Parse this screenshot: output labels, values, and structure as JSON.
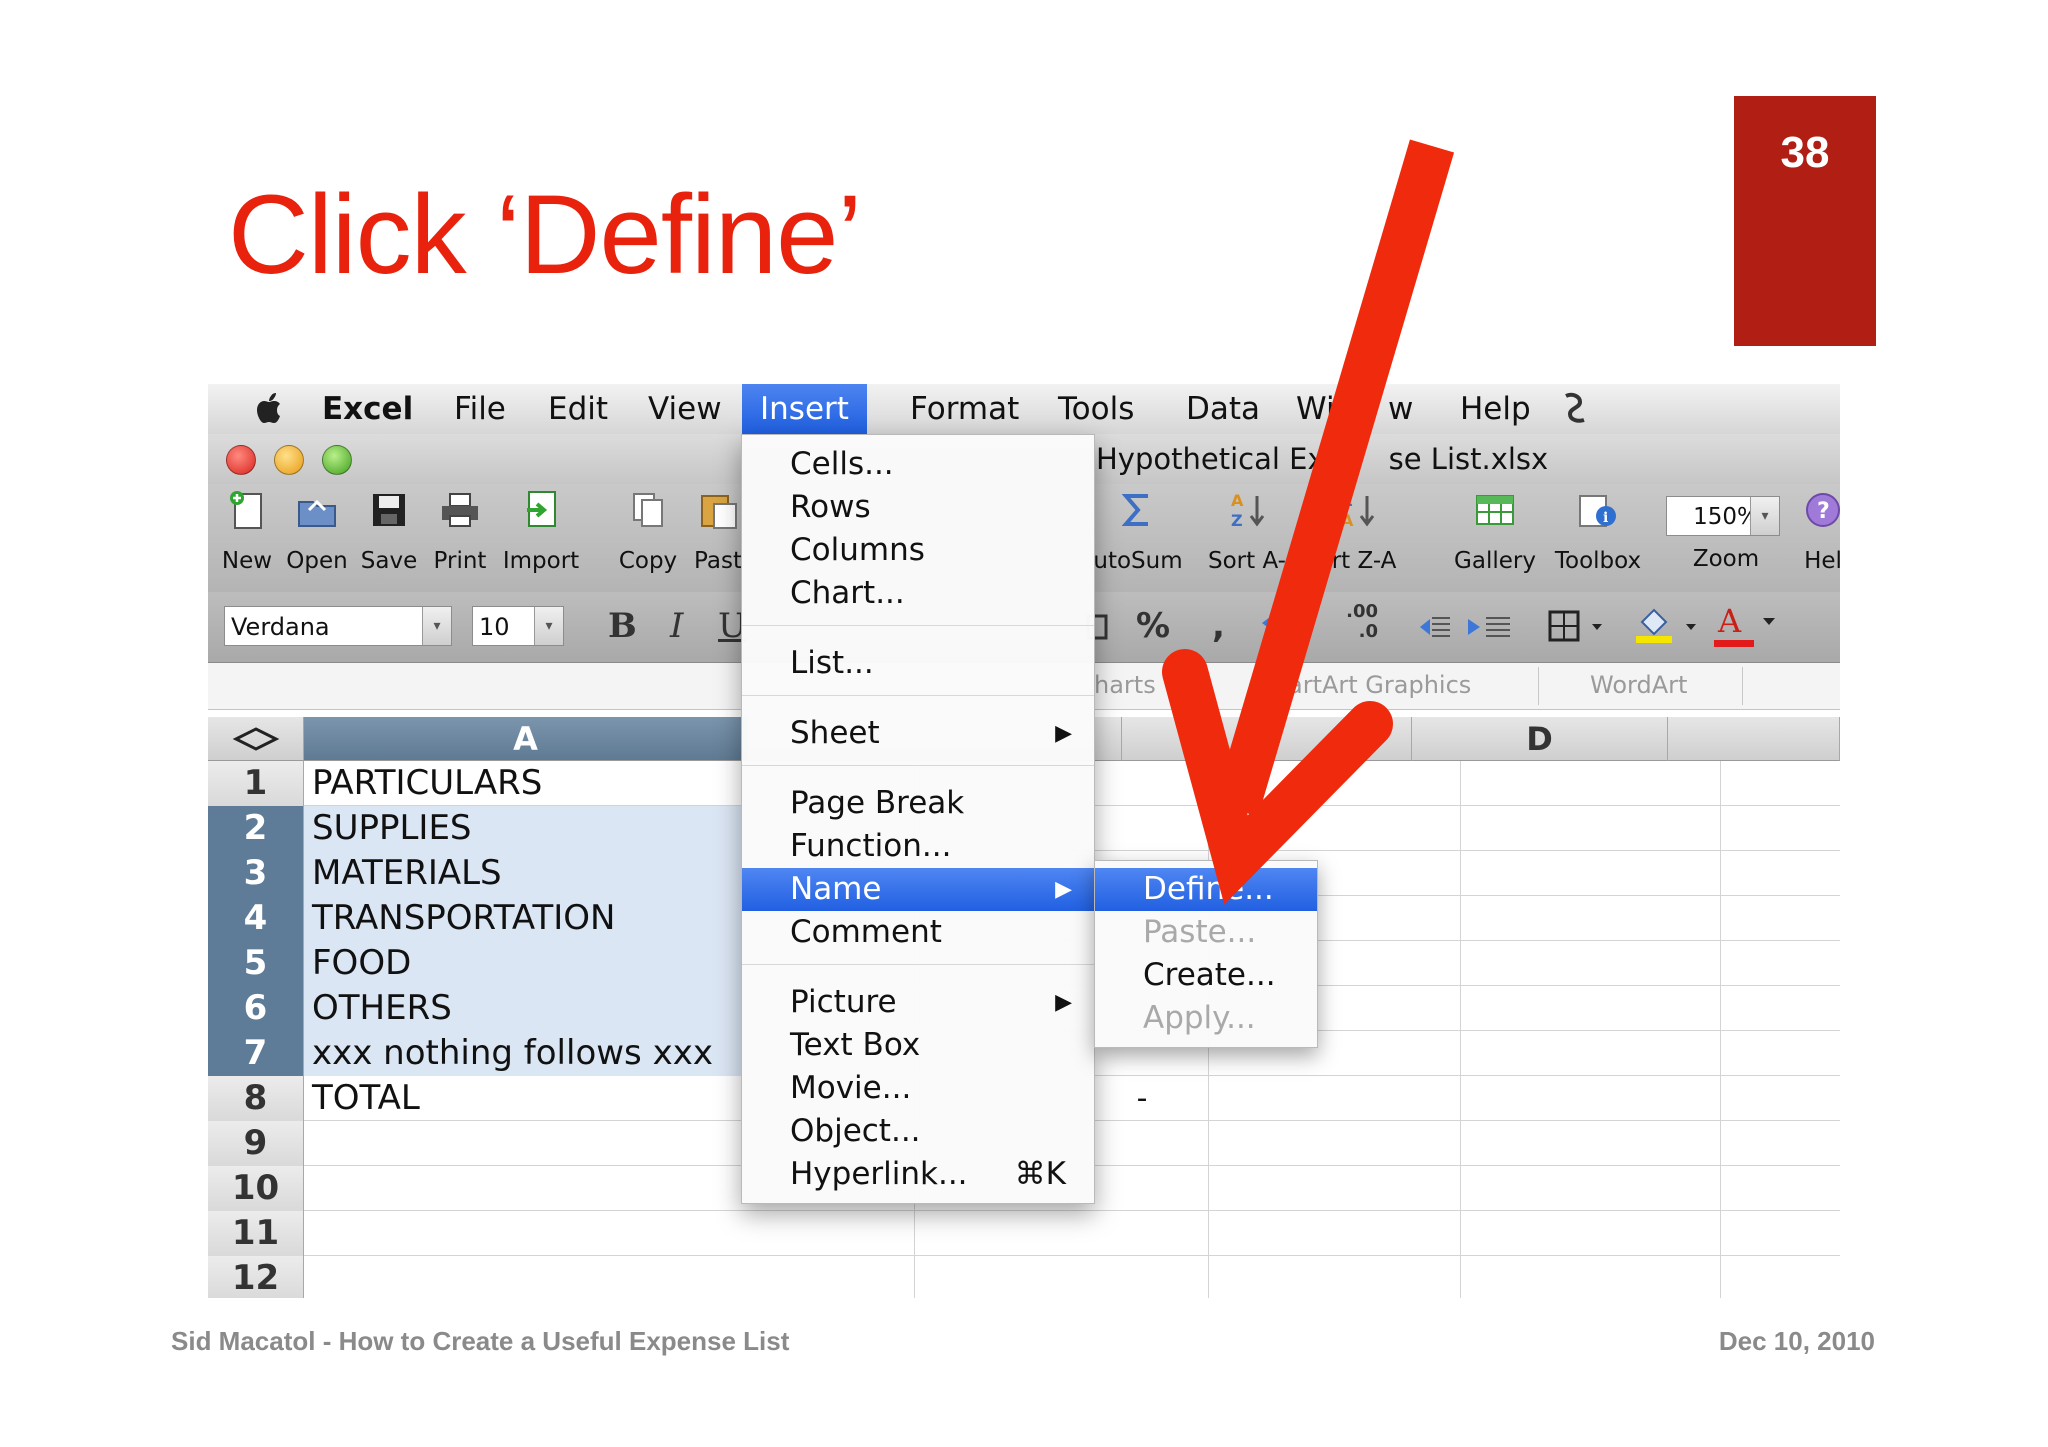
{
  "slide": {
    "title": "Click ‘Define’",
    "page_number": "38",
    "footer_left": "Sid Macatol - How to Create a Useful Expense List",
    "footer_right": "Dec 10, 2010"
  },
  "colors": {
    "title_red": "#e8220c",
    "badge_red": "#b01e14",
    "menu_highlight": "#2a66e6"
  },
  "menubar": {
    "app": "Excel",
    "items": [
      "File",
      "Edit",
      "View",
      "Insert",
      "Format",
      "Tools",
      "Data",
      "Win",
      "w",
      "Help"
    ],
    "active": "Insert"
  },
  "window": {
    "title_left": "Hypothetical Ex",
    "title_right": "se List.xlsx"
  },
  "toolbar": {
    "buttons": [
      {
        "label": "New",
        "icon": "new-document-icon"
      },
      {
        "label": "Open",
        "icon": "open-folder-icon"
      },
      {
        "label": "Save",
        "icon": "save-disk-icon"
      },
      {
        "label": "Print",
        "icon": "printer-icon"
      },
      {
        "label": "Import",
        "icon": "import-icon"
      },
      {
        "label": "Copy",
        "icon": "copy-icon"
      },
      {
        "label": "Past",
        "icon": "paste-icon"
      },
      {
        "label": "utoSum",
        "icon": "sigma-icon"
      },
      {
        "label": "Sort A-",
        "icon": "sort-ascending-icon"
      },
      {
        "label": "ort Z-A",
        "icon": "sort-descending-icon"
      },
      {
        "label": "Gallery",
        "icon": "gallery-icon"
      },
      {
        "label": "Toolbox",
        "icon": "toolbox-icon"
      },
      {
        "label": "Zoom",
        "icon": "zoom-icon"
      },
      {
        "label": "Hel",
        "icon": "help-icon"
      }
    ],
    "zoom_value": "150%"
  },
  "formatting": {
    "font_name": "Verdana",
    "font_size": "10",
    "bold": "B",
    "italic": "I",
    "percent": "%",
    "comma": ",",
    "increase_decimal": ".00",
    "decrease_decimal": ".0",
    "font_color_label": "A"
  },
  "ribbon": {
    "groups": [
      "harts",
      "artArt Graphics",
      "WordArt"
    ]
  },
  "sheet": {
    "column_headers": [
      "A",
      "D"
    ],
    "rows": [
      {
        "num": "1",
        "a": "PARTICULARS",
        "selected": false
      },
      {
        "num": "2",
        "a": "SUPPLIES",
        "selected": true
      },
      {
        "num": "3",
        "a": "MATERIALS",
        "selected": true
      },
      {
        "num": "4",
        "a": "TRANSPORTATION",
        "selected": true
      },
      {
        "num": "5",
        "a": "FOOD",
        "selected": true
      },
      {
        "num": "6",
        "a": "OTHERS",
        "selected": true
      },
      {
        "num": "7",
        "a": "xxx nothing follows xxx",
        "selected": true
      },
      {
        "num": "8",
        "a": "TOTAL",
        "selected": false
      },
      {
        "num": "9",
        "a": "",
        "selected": false
      },
      {
        "num": "10",
        "a": "",
        "selected": false
      },
      {
        "num": "11",
        "a": "",
        "selected": false
      },
      {
        "num": "12",
        "a": "",
        "selected": false
      }
    ],
    "total_dash": "-"
  },
  "insert_menu": {
    "items": [
      "Cells...",
      "Rows",
      "Columns",
      "Chart...",
      "List...",
      "Sheet",
      "Page Break",
      "Function...",
      "Name",
      "Comment",
      "Picture",
      "Text Box",
      "Movie...",
      "Object...",
      "Hyperlink..."
    ],
    "highlighted": "Name",
    "hyperlink_shortcut": "⌘K"
  },
  "name_submenu": {
    "items": [
      "Define...",
      "Paste...",
      "Create...",
      "Apply..."
    ],
    "highlighted": "Define...",
    "disabled": [
      "Paste...",
      "Apply..."
    ]
  }
}
